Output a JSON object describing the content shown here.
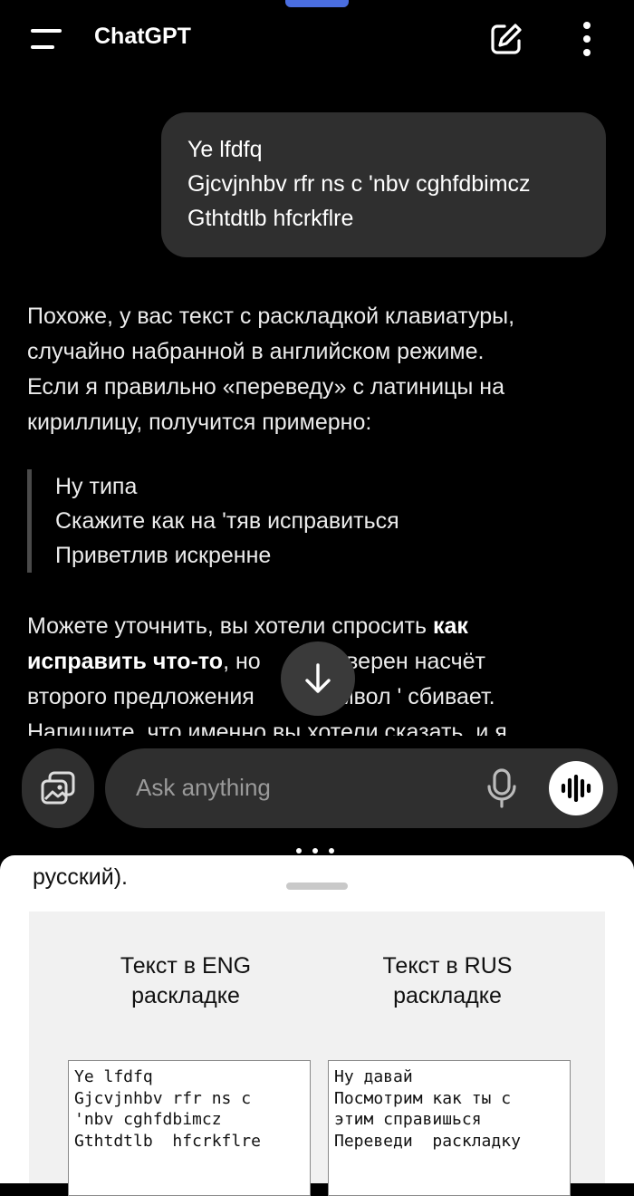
{
  "header": {
    "title": "ChatGPT"
  },
  "user_message": {
    "lines": [
      "Ye lfdfq",
      "Gjcvjnhbv rfr ns с 'nbv cghfdbimcz",
      "Gthtdtlb  hfcrkflre"
    ]
  },
  "assistant": {
    "para1": [
      "Похоже, у вас текст с раскладкой клавиатуры,",
      "случайно набранной в английском режиме.",
      "Если я правильно «переведу» с латиницы на",
      "кириллицу, получится примерно:"
    ],
    "quote": [
      "Ну типа",
      "Скажите как на 'тяв исправиться",
      "Приветлив искренне"
    ],
    "para2": {
      "l1_a": "Можете уточнить, вы хотели спросить ",
      "l1_b": "как",
      "l2_a": "исправить что-то",
      "l2_b": ", но",
      "l2_c": "уверен насчёт",
      "l3_a": "второго предложения",
      "l3_b": "м символ  '  сбивает.",
      "l4": "Напишите, что именно вы хотели сказать, и я"
    }
  },
  "composer": {
    "placeholder": "Ask anything"
  },
  "sheet": {
    "partial_text": "русский).",
    "left_title": [
      "Текст в ENG",
      "раскладке"
    ],
    "right_title": [
      "Текст в RUS",
      "раскладке"
    ],
    "left_text": [
      "Ye lfdfq",
      "Gjcvjnhbv rfr ns c",
      "'nbv cghfdbimcz",
      "Gthtdtlb  hfcrkflre"
    ],
    "right_text": [
      "Ну давай",
      "Посмотрим как ты с",
      "этим справишься",
      "Переведи  раскладку"
    ]
  },
  "colors": {
    "accent": "#4a6ee0",
    "bubble": "#2f2f2f",
    "background": "#000000"
  }
}
